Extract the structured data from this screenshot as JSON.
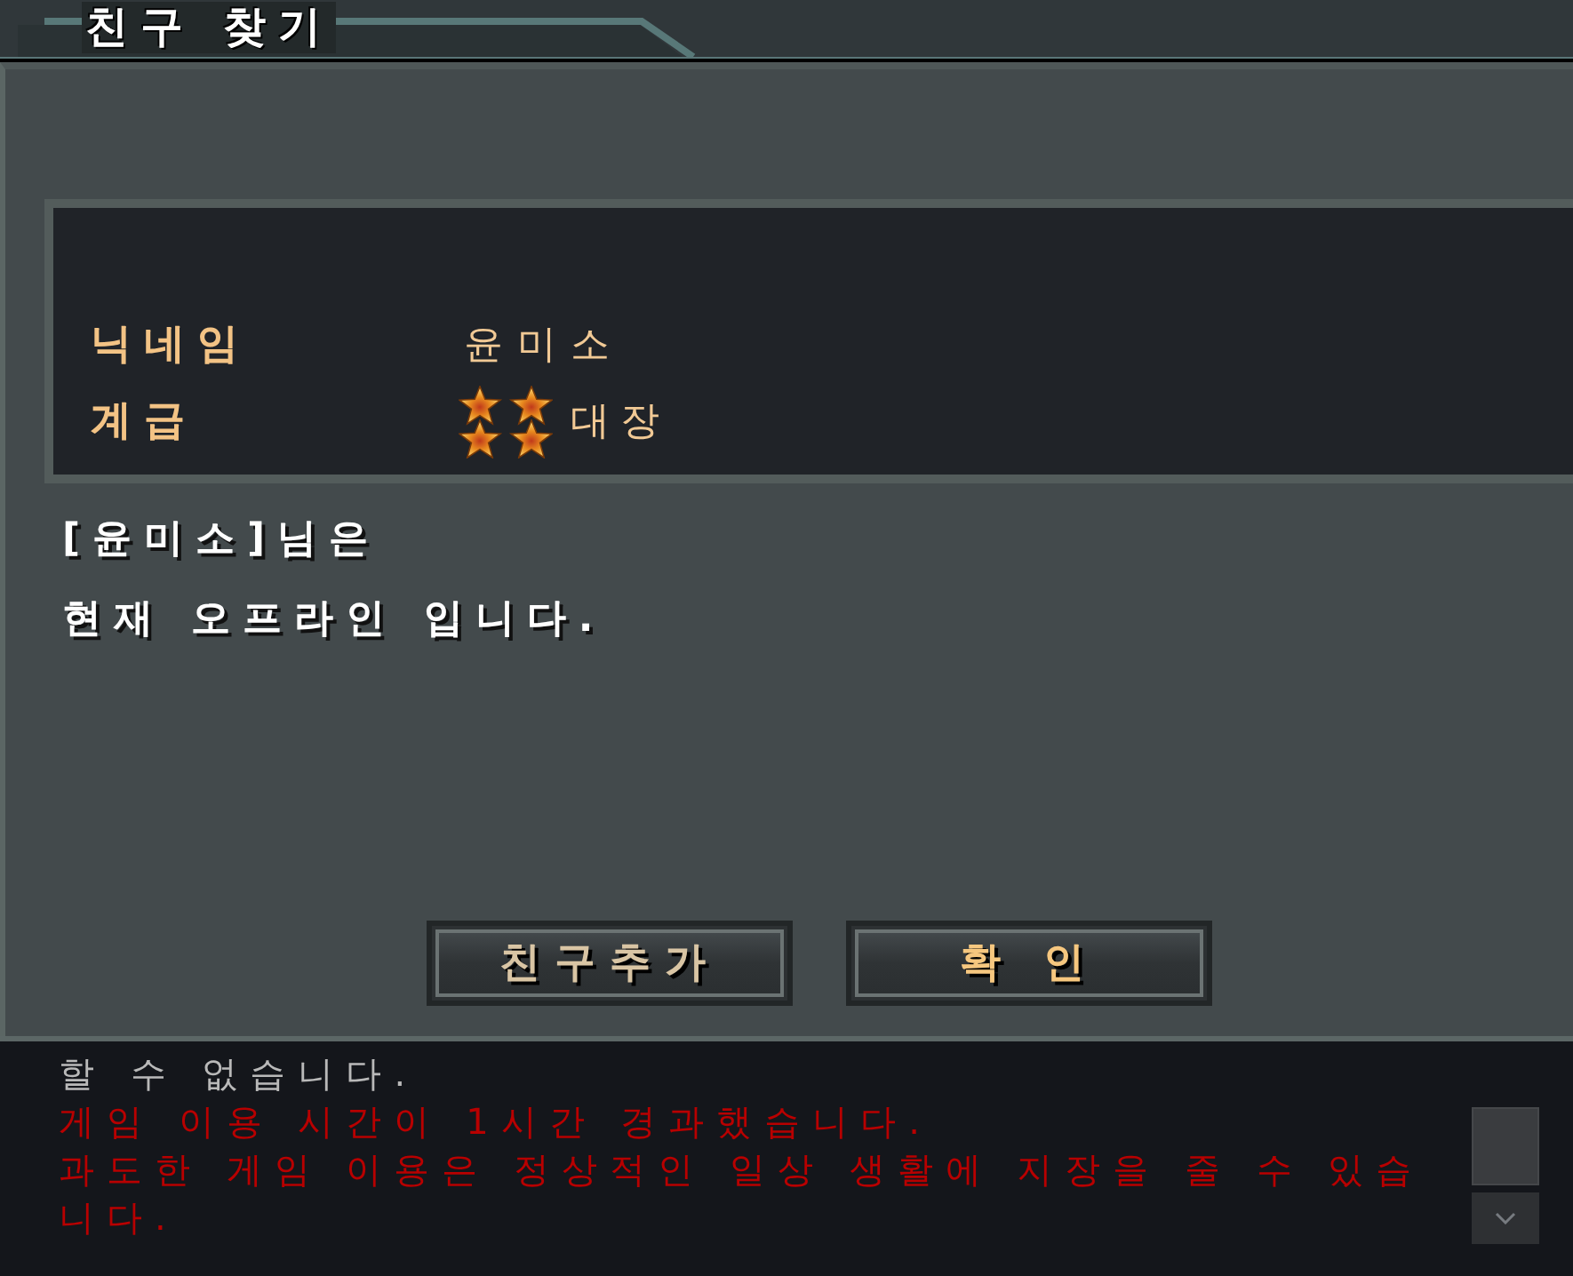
{
  "window": {
    "title": "친구 찾기"
  },
  "profile": {
    "fields": [
      {
        "kind": "text",
        "label": "닉네임",
        "value": "윤미소"
      },
      {
        "kind": "rank",
        "label": "계급",
        "value": "대장"
      }
    ]
  },
  "message": [
    "[윤미소]님은",
    "현재 오프라인 입니다."
  ],
  "buttons": [
    {
      "label": "친구추가",
      "kind": "secondary"
    },
    {
      "label": "확 인",
      "kind": "primary"
    }
  ],
  "chat": {
    "lines": [
      {
        "kind": "system",
        "text": "할 수 없습니다."
      },
      {
        "kind": "warning",
        "text": "게임 이용 시간이 1시간 경과했습니다."
      },
      {
        "kind": "warning",
        "text": "과도한 게임 이용은 정상적인 일상 생활에 지장을 줄 수 있습니다."
      }
    ]
  }
}
